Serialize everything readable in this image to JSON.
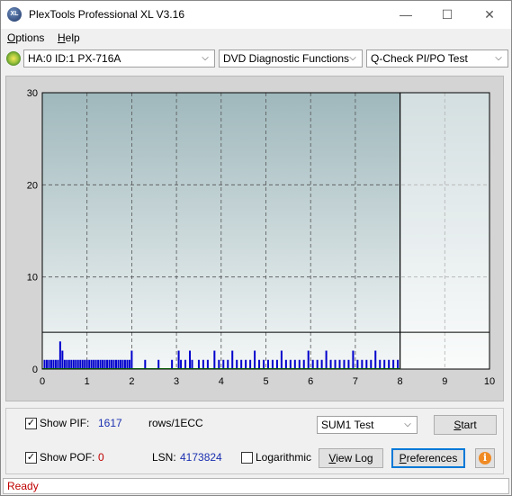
{
  "window": {
    "title": "PlexTools Professional XL V3.16",
    "app_icon_text": "XL",
    "controls": {
      "minimize": "—",
      "maximize": "☐",
      "close": "✕"
    }
  },
  "menu": {
    "options": {
      "underlined": "O",
      "rest": "ptions"
    },
    "help": {
      "underlined": "H",
      "rest": "elp"
    }
  },
  "toolbar": {
    "drive": "HA:0 ID:1  PX-716A",
    "function": "DVD Diagnostic Functions",
    "test": "Q-Check PI/PO Test",
    "dropdown_arrow": "⌵"
  },
  "chart_data": {
    "type": "bar",
    "x_ticks": [
      "0",
      "1",
      "2",
      "3",
      "4",
      "5",
      "6",
      "7",
      "8",
      "9",
      "10"
    ],
    "y_ticks": [
      "0",
      "10",
      "20",
      "30"
    ],
    "xlim": [
      0,
      10
    ],
    "ylim": [
      0,
      30
    ],
    "grid": true,
    "threshold": 4,
    "scan_end": 8,
    "series": [
      {
        "color": "#0000cc",
        "x": [
          0.05,
          0.1,
          0.15,
          0.2,
          0.25,
          0.3,
          0.35,
          0.4,
          0.45,
          0.5,
          0.55,
          0.6,
          0.65,
          0.7,
          0.75,
          0.8,
          0.85,
          0.9,
          0.95,
          1.0,
          1.05,
          1.1,
          1.15,
          1.2,
          1.25,
          1.3,
          1.35,
          1.4,
          1.45,
          1.5,
          1.55,
          1.6,
          1.65,
          1.7,
          1.75,
          1.8,
          1.85,
          1.9,
          1.95,
          2.0,
          2.3,
          2.6,
          2.9,
          3.05,
          3.1,
          3.2,
          3.3,
          3.35,
          3.5,
          3.6,
          3.7,
          3.85,
          3.95,
          4.05,
          4.15,
          4.25,
          4.35,
          4.45,
          4.55,
          4.65,
          4.75,
          4.85,
          4.95,
          5.05,
          5.15,
          5.25,
          5.35,
          5.45,
          5.55,
          5.65,
          5.75,
          5.85,
          5.95,
          6.05,
          6.15,
          6.25,
          6.35,
          6.45,
          6.55,
          6.65,
          6.75,
          6.85,
          6.95,
          7.05,
          7.15,
          7.25,
          7.35,
          7.45,
          7.55,
          7.65,
          7.75,
          7.85,
          7.95
        ],
        "values": [
          1,
          1,
          1,
          1,
          1,
          1,
          1,
          3,
          2,
          1,
          1,
          1,
          1,
          1,
          1,
          1,
          1,
          1,
          1,
          1,
          1,
          1,
          1,
          1,
          1,
          1,
          1,
          1,
          1,
          1,
          1,
          1,
          1,
          1,
          1,
          1,
          1,
          1,
          1,
          2,
          1,
          1,
          1,
          2,
          1,
          1,
          2,
          1,
          1,
          1,
          1,
          2,
          1,
          1,
          1,
          2,
          1,
          1,
          1,
          1,
          2,
          1,
          1,
          1,
          1,
          1,
          2,
          1,
          1,
          1,
          1,
          1,
          2,
          1,
          1,
          1,
          2,
          1,
          1,
          1,
          1,
          1,
          2,
          1,
          1,
          1,
          1,
          2,
          1,
          1,
          1,
          1,
          1
        ]
      }
    ]
  },
  "bottom": {
    "show_pif_label": "Show PIF:",
    "pif_value": "1617",
    "rows_label": "rows/1ECC",
    "show_pof_label": "Show POF:",
    "pof_value": "0",
    "lsn_label": "LSN:",
    "lsn_value": "4173824",
    "logarithmic_label": "Logarithmic",
    "sum_select": "SUM1 Test",
    "start_button": {
      "underlined": "S",
      "rest": "tart"
    },
    "view_log_button": {
      "underlined": "V",
      "rest": "iew Log"
    },
    "preferences_button": {
      "underlined": "P",
      "rest": "references"
    },
    "info_glyph": "i"
  },
  "status": {
    "text": "Ready"
  }
}
